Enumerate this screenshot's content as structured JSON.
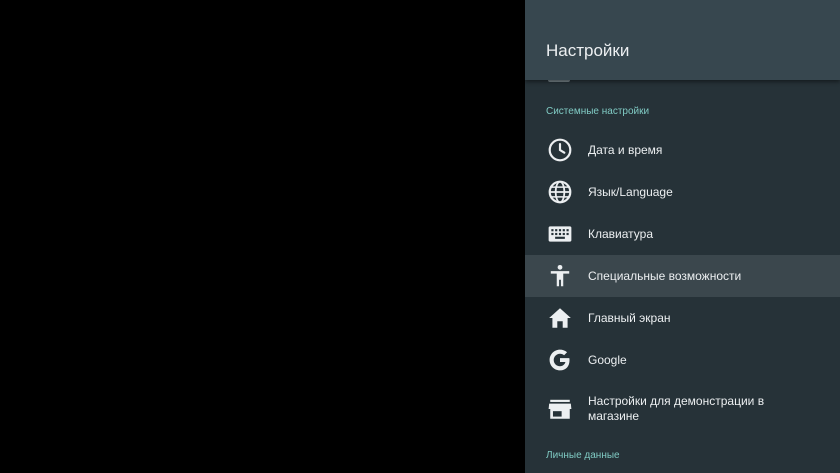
{
  "panel": {
    "title": "Настройки"
  },
  "sections": {
    "system_title": "Системные настройки",
    "personal_title": "Личные данные"
  },
  "items": [
    {
      "label": "Дата и время",
      "icon": "clock-icon"
    },
    {
      "label": "Язык/Language",
      "icon": "globe-icon"
    },
    {
      "label": "Клавиатура",
      "icon": "keyboard-icon"
    },
    {
      "label": "Специальные возможности",
      "icon": "accessibility-icon"
    },
    {
      "label": "Главный экран",
      "icon": "home-icon"
    },
    {
      "label": "Google",
      "icon": "google-icon"
    },
    {
      "label": "Настройки для демонстрации в магазине",
      "icon": "store-icon"
    }
  ],
  "colors": {
    "panel_bg": "#263238",
    "header_bg": "#37474f",
    "focus_bg": "#3b474d",
    "section_accent": "#80cbc4",
    "text": "#eceff1"
  },
  "focused_index": 3
}
